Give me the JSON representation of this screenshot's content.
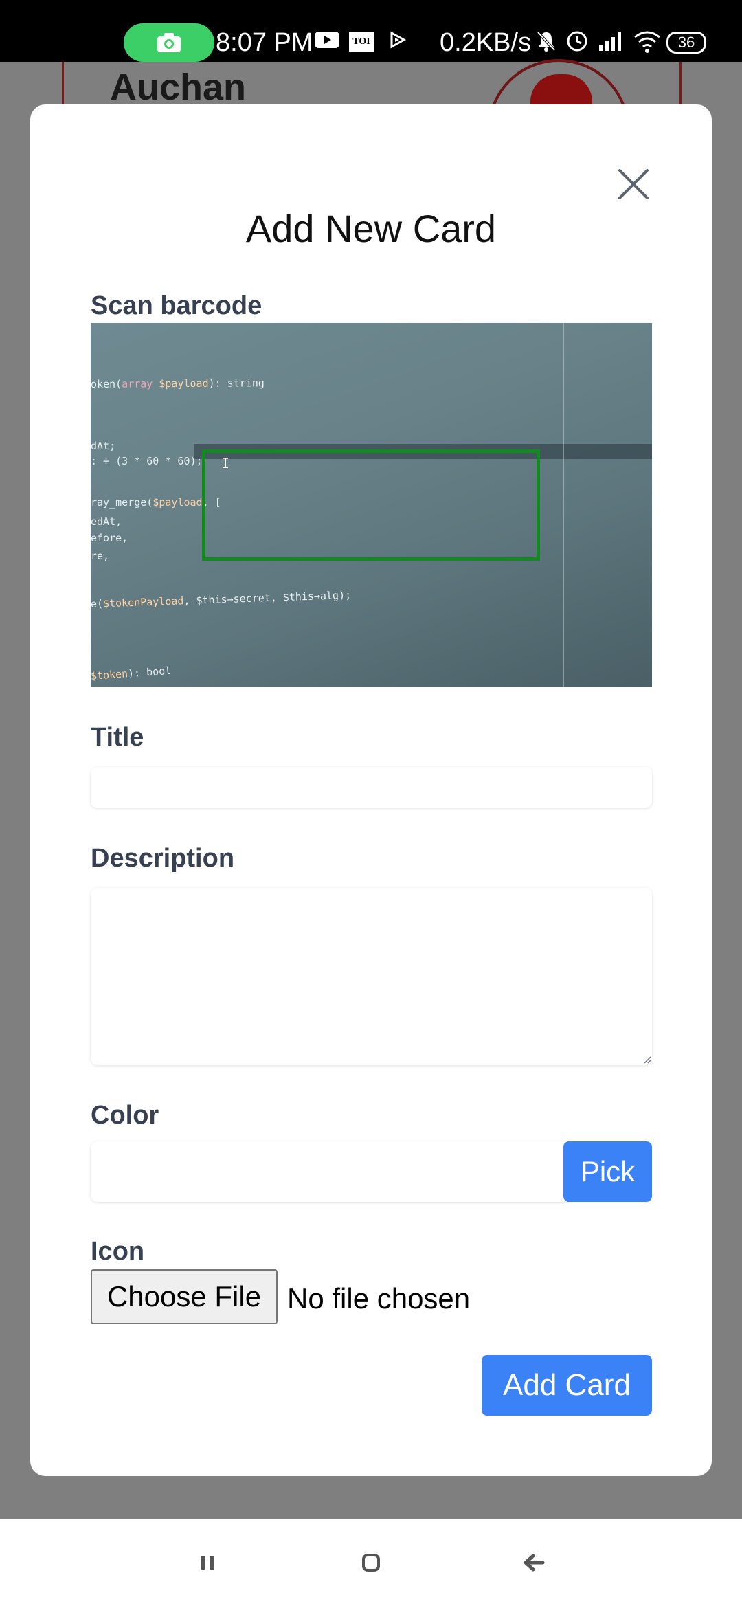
{
  "status_bar": {
    "time": "8:07 PM",
    "network_speed": "0.2KB/s",
    "battery": "36",
    "icons": [
      "camera-icon",
      "youtube-icon",
      "toi-icon",
      "play-icon",
      "mute-icon",
      "alarm-icon",
      "signal-icon",
      "wifi-icon",
      "battery-icon"
    ],
    "toi_label": "TOI"
  },
  "background_page": {
    "card_title": "Auchan",
    "colors": {
      "card_border": "#7a1b1b",
      "logo": "#8a1010"
    }
  },
  "modal": {
    "title": "Add New Card",
    "close_icon": "close-icon",
    "scan_label": "Scan barcode",
    "scanner_code_lines": [
      {
        "pre": "oken(",
        "kw": "array ",
        "var": "$payload",
        "post": "): string"
      },
      {
        "pre": "dAt;",
        "kw": "",
        "var": "",
        "post": ""
      },
      {
        "pre": ": +  (3 * 60 * 60);",
        "kw": "",
        "var": "",
        "post": ""
      },
      {
        "pre": "ray_merge(",
        "kw": "",
        "var": "$payload",
        "post": ", ["
      },
      {
        "pre": "edAt,",
        "kw": "",
        "var": "",
        "post": ""
      },
      {
        "pre": "efore,",
        "kw": "",
        "var": "",
        "post": ""
      },
      {
        "pre": "re,",
        "kw": "",
        "var": "",
        "post": ""
      },
      {
        "pre": "e(",
        "kw": "",
        "var": "$tokenPayload",
        "post": ", $this→secret, $this→alg);"
      },
      {
        "pre": "         ",
        "kw": "",
        "var": "$token",
        "post": "): bool"
      }
    ],
    "title_label": "Title",
    "title_value": "",
    "description_label": "Description",
    "description_value": "",
    "color_label": "Color",
    "color_value": "",
    "pick_label": "Pick",
    "icon_label": "Icon",
    "choose_file_label": "Choose File",
    "file_status": "No file chosen",
    "submit_label": "Add Card"
  },
  "nav_bar": {
    "icons": [
      "recents-icon",
      "home-icon",
      "back-icon"
    ]
  },
  "colors": {
    "accent": "#3b82f6",
    "scan_frame": "#138a1f",
    "overlay": "#7f7f7f",
    "label_text": "#374151"
  }
}
